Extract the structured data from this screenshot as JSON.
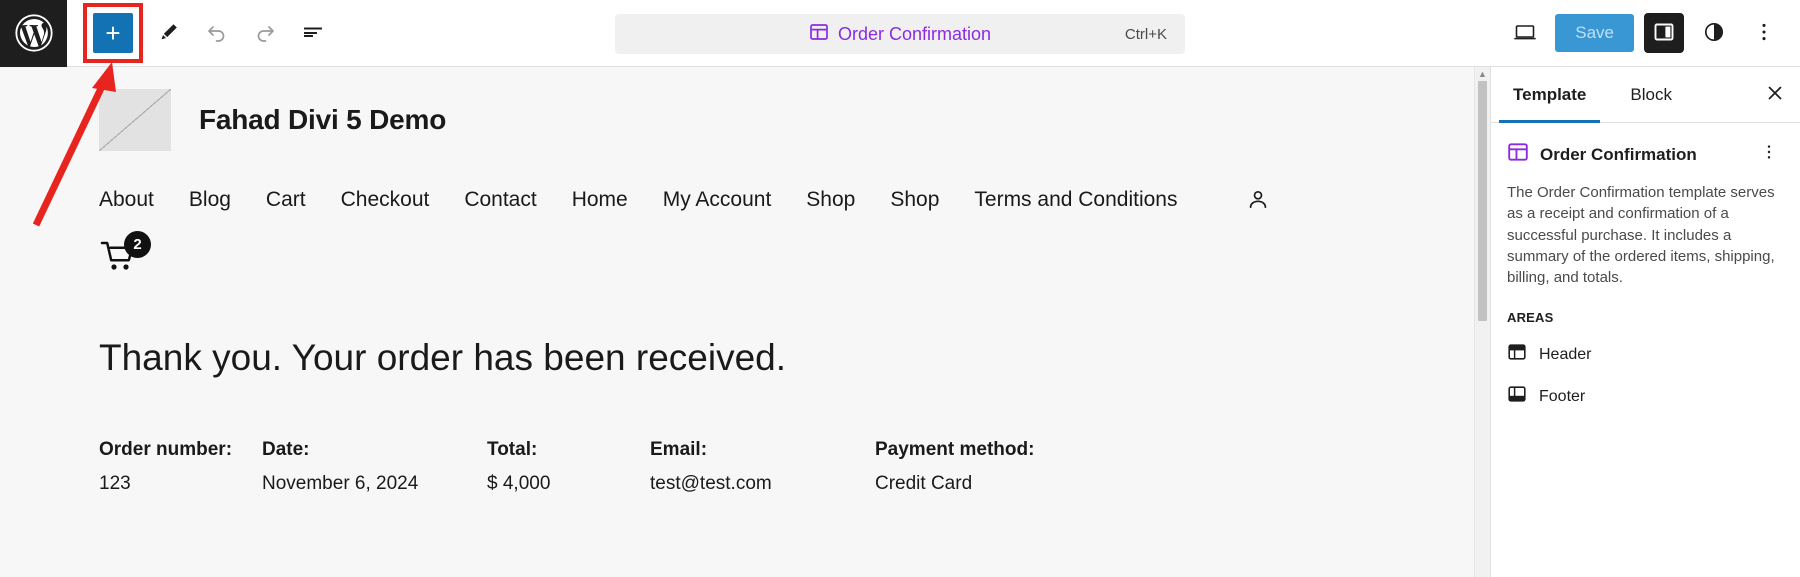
{
  "topbar": {
    "wp_logo": "wordpress-logo",
    "add_block_label": "+",
    "tools": [
      "edit-pencil",
      "undo",
      "redo",
      "list-view"
    ],
    "command_bar": {
      "icon": "template-icon",
      "title": "Order Confirmation",
      "shortcut": "Ctrl+K"
    },
    "view_icon": "desktop-view-icon",
    "save_label": "Save",
    "settings_icon": "settings-sidebar-icon",
    "styles_icon": "styles-contrast-icon",
    "options_icon": "more-options-icon"
  },
  "canvas": {
    "site_title": "Fahad Divi 5 Demo",
    "logo_alt": "site-logo-placeholder",
    "nav": [
      "About",
      "Blog",
      "Cart",
      "Checkout",
      "Contact",
      "Home",
      "My Account",
      "Shop",
      "Shop",
      "Terms and Conditions"
    ],
    "account_icon": "user-account-icon",
    "cart_icon": "shopping-cart-icon",
    "cart_count": "2",
    "heading": "Thank you. Your order has been received.",
    "order_details": [
      {
        "label": "Order number:",
        "value": "123"
      },
      {
        "label": "Date:",
        "value": "November 6, 2024"
      },
      {
        "label": "Total:",
        "value": "$ 4,000"
      },
      {
        "label": "Email:",
        "value": "test@test.com"
      },
      {
        "label": "Payment method:",
        "value": "Credit Card"
      }
    ]
  },
  "sidebar": {
    "tabs": [
      {
        "label": "Template",
        "active": true
      },
      {
        "label": "Block",
        "active": false
      }
    ],
    "close_icon": "close-icon",
    "template": {
      "icon": "template-icon",
      "name": "Order Confirmation",
      "description": "The Order Confirmation template serves as a receipt and confirmation of a successful purchase. It includes a summary of the ordered items, shipping, billing, and totals.",
      "areas_label": "AREAS",
      "areas": [
        {
          "label": "Header",
          "icon": "header-area-icon"
        },
        {
          "label": "Footer",
          "icon": "footer-area-icon"
        }
      ]
    }
  },
  "colors": {
    "accent_blue": "#1272b4",
    "purple": "#8c2be2",
    "annotation_red": "#e8241f",
    "dark": "#1e1e1e"
  }
}
